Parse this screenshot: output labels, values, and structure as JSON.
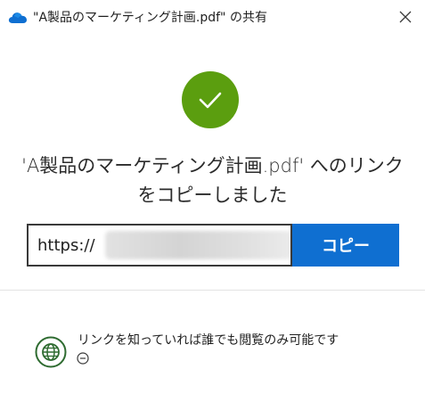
{
  "window": {
    "title": "\"A製品のマーケティング計画.pdf\" の共有",
    "close_icon": "close-icon",
    "app_icon": "onedrive-cloud-icon"
  },
  "status": {
    "icon": "checkmark-icon",
    "color": "#5b9e0f",
    "heading_line1": "'A製品のマーケティング計画.pdf' へのリンク",
    "heading_line2": "をコピーしました"
  },
  "link": {
    "value": "https://",
    "copy_label": "コピー",
    "button_color": "#0f6fd1"
  },
  "permission": {
    "icon": "globe-icon",
    "icon_color": "#2e6b30",
    "text": "リンクを知っていれば誰でも閲覧のみ可能です",
    "toggle_icon": "collapse-circle-icon"
  }
}
